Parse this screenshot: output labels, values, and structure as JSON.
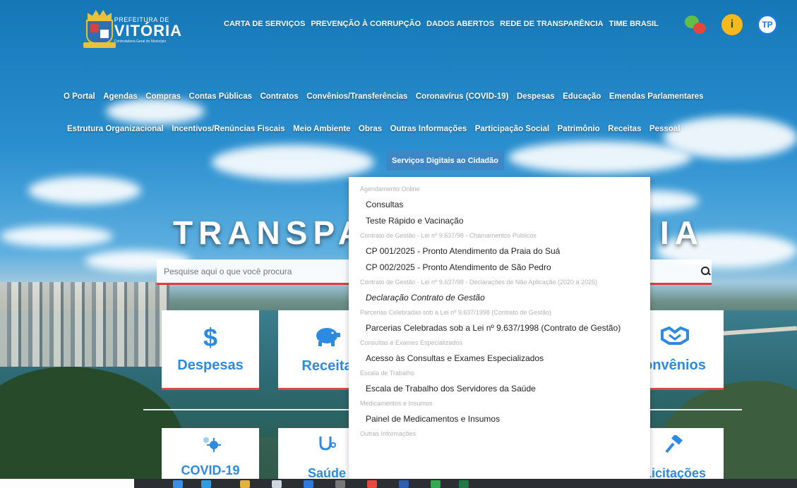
{
  "logo": {
    "line1": "PREFEITURA DE",
    "line2": "VITÓRIA",
    "line3": "Controladoria Geral do Município"
  },
  "top_nav": [
    "CARTA DE SERVIÇOS",
    "PREVENÇÃO À CORRUPÇÃO",
    "DADOS ABERTOS",
    "REDE DE TRANSPARÊNCIA",
    "TIME BRASIL"
  ],
  "header_icons": {
    "chat": "chat-bubbles-icon",
    "info": "i",
    "tp": "TP"
  },
  "main_nav": [
    "O Portal",
    "Agendas",
    "Compras",
    "Contas Públicas",
    "Contratos",
    "Convênios/Transferências",
    "Coronavírus (COVID-19)",
    "Despesas",
    "Educação",
    "Emendas Parlamentares"
  ],
  "secondary_nav": [
    "Estrutura Organizacional",
    "Incentivos/Renúncias Fiscais",
    "Meio Ambiente",
    "Obras",
    "Outras Informações",
    "Participação Social",
    "Patrimônio",
    "Receitas",
    "Pessoal"
  ],
  "active_menu": "Serviços Digitais ao Cidadão",
  "hero": {
    "title_left": "TRANSPA",
    "title_right": "IA"
  },
  "search": {
    "placeholder": "Pesquise aqui o que você procura"
  },
  "cards": [
    {
      "label": "Despesas",
      "icon": "$"
    },
    {
      "label": "Receita",
      "icon": "piggy-bank-icon"
    },
    {
      "label": "onvênios",
      "icon": "handshake-icon"
    }
  ],
  "cards_bottom": [
    {
      "label": "COVID-19",
      "icon": "virus-icon"
    },
    {
      "label": "Saúde",
      "icon": "stethoscope-icon"
    },
    {
      "label": "Licitações",
      "icon": "gavel-icon"
    }
  ],
  "dropdown": {
    "groups": [
      {
        "heading": "Agendamento Online",
        "items": [
          "Consultas",
          "Teste Rápido e Vacinação"
        ]
      },
      {
        "heading": "Contrato de Gestão - Lei nº 9.637/98 - Chamamentos Públicos",
        "items": [
          "CP 001/2025 - Pronto Atendimento da Praia do Suá",
          "CP 002/2025 - Pronto Atendimento de São Pedro"
        ]
      },
      {
        "heading": "Contrato de Gestão - Lei nº 9.637/98 - Declarações de Não Aplicação (2020 a 2025)",
        "items": [
          "Declaração Contrato de Gestão"
        ]
      },
      {
        "heading": "Parcerias Celebradas sob a Lei nº 9.637/1998 (Contrato de Gestão)",
        "items": [
          "Parcerias Celebradas sob a Lei nº 9.637/1998 (Contrato de Gestão)"
        ]
      },
      {
        "heading": "Consultas e Exames Especializados",
        "items": [
          "Acesso às Consultas e Exames Especializados"
        ]
      },
      {
        "heading": "Escala de Trabalho",
        "items": [
          "Escala de Trabalho dos Servidores da Saúde"
        ]
      },
      {
        "heading": "Medicamentos e Insumos",
        "items": [
          "Painel de Medicamentos e Insumos"
        ]
      },
      {
        "heading": "Outras Informações",
        "items": []
      }
    ]
  },
  "colors": {
    "accent": "#2c8ae0",
    "underline": "#e04a44",
    "active_tab": "#3d87c6"
  }
}
